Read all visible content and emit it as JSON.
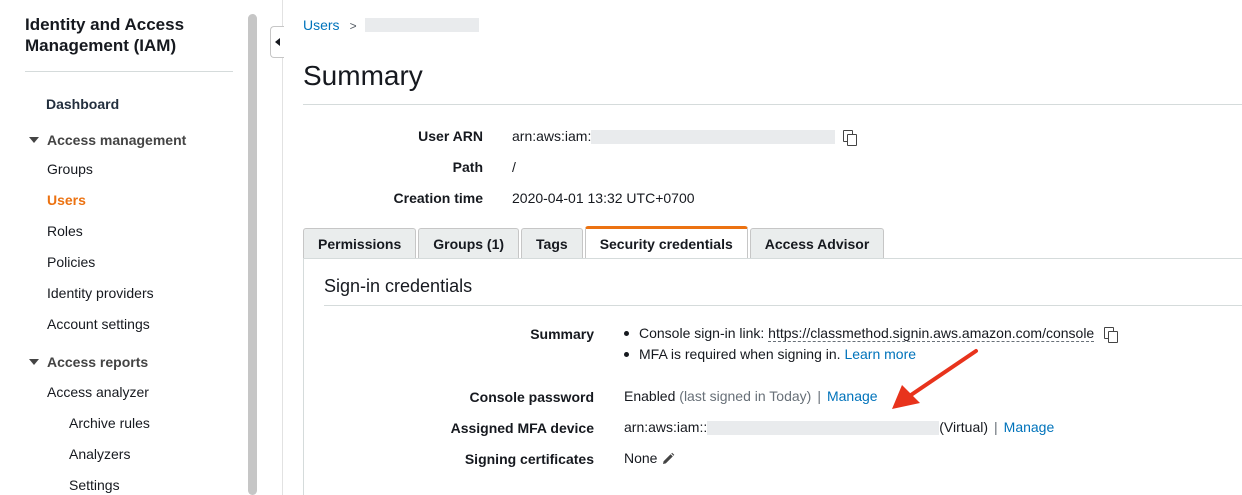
{
  "sidebar": {
    "title": "Identity and Access Management (IAM)",
    "dashboard": "Dashboard",
    "access_management": {
      "label": "Access management",
      "items": [
        "Groups",
        "Users",
        "Roles",
        "Policies",
        "Identity providers",
        "Account settings"
      ],
      "active": "Users"
    },
    "access_reports": {
      "label": "Access reports",
      "items": [
        "Access analyzer"
      ],
      "subitems": [
        "Archive rules",
        "Analyzers",
        "Settings"
      ]
    }
  },
  "breadcrumb": {
    "root": "Users",
    "separator": ">"
  },
  "page": {
    "title": "Summary"
  },
  "summary": {
    "user_arn_label": "User ARN",
    "user_arn_prefix": "arn:aws:iam:",
    "path_label": "Path",
    "path_value": "/",
    "creation_label": "Creation time",
    "creation_value": "2020-04-01 13:32 UTC+0700"
  },
  "tabs": {
    "items": [
      "Permissions",
      "Groups (1)",
      "Tags",
      "Security credentials",
      "Access Advisor"
    ],
    "active": "Security credentials"
  },
  "signin": {
    "title": "Sign-in credentials",
    "summary_label": "Summary",
    "console_link_text": "Console sign-in link: ",
    "console_link_url": "https://classmethod.signin.aws.amazon.com/console",
    "mfa_required_text": "MFA is required when signing in.",
    "learn_more": "Learn more",
    "console_password_label": "Console password",
    "console_password_status": "Enabled",
    "console_password_note": "(last signed in Today)",
    "pipe": "|",
    "manage_label": "Manage",
    "mfa_label": "Assigned MFA device",
    "mfa_prefix": "arn:aws:iam::",
    "mfa_type": "(Virtual)",
    "signing_label": "Signing certificates",
    "signing_value": "None"
  },
  "colors": {
    "accent": "#ec7211",
    "link": "#0073bb",
    "annotation_arrow": "#e8331c"
  }
}
